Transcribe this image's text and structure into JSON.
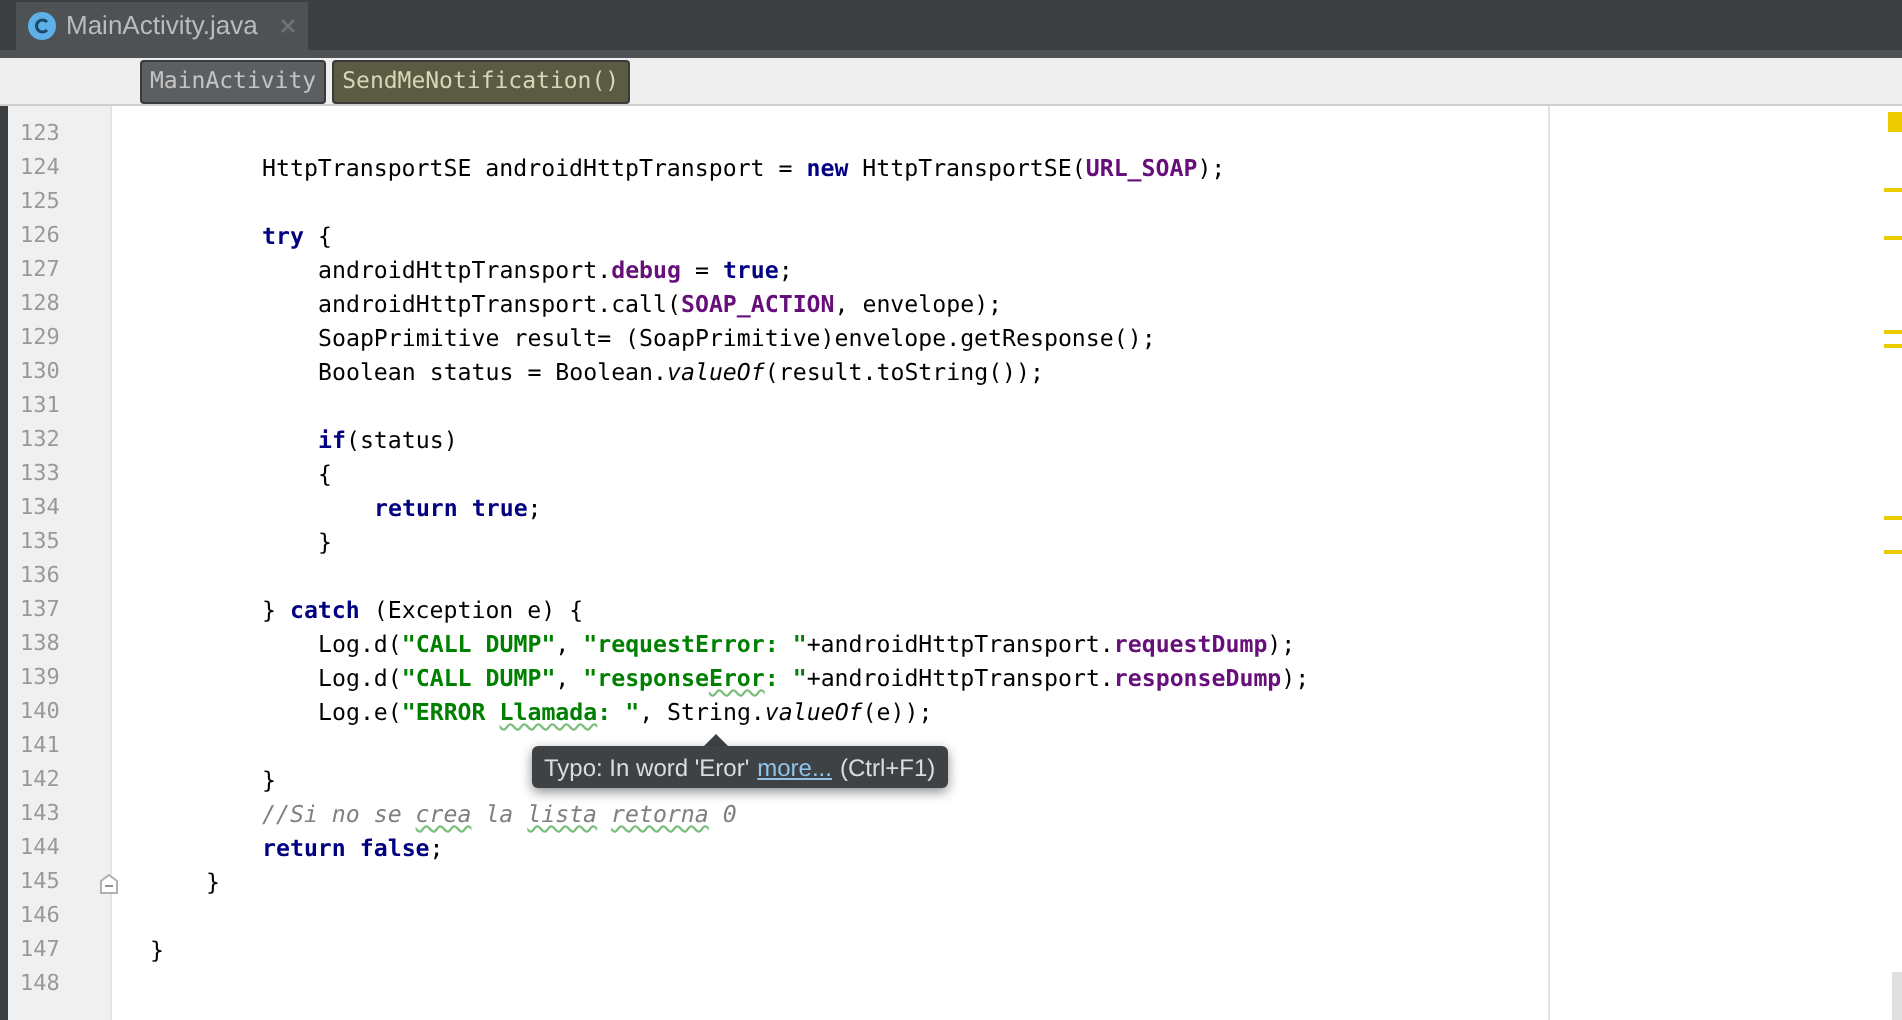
{
  "tabs": [
    {
      "label": "MainActivity.java",
      "selected": true
    }
  ],
  "breadcrumbs": [
    {
      "label": "MainActivity",
      "selected": false
    },
    {
      "label": "SendMeNotification()",
      "selected": true
    }
  ],
  "editor": {
    "lines": [
      {
        "number": "123",
        "fold": false
      },
      {
        "number": "124",
        "fold": false,
        "tokens": [
          {
            "text": "        HttpTransportSE androidHttpTransport = ",
            "kind": "plain"
          },
          {
            "text": "new",
            "kind": "keyword"
          },
          {
            "text": " HttpTransportSE(",
            "kind": "plain"
          },
          {
            "text": "URL_SOAP",
            "kind": "field"
          },
          {
            "text": ");",
            "kind": "plain"
          }
        ]
      },
      {
        "number": "125",
        "fold": false
      },
      {
        "number": "126",
        "fold": false,
        "tokens": [
          {
            "text": "        try",
            "kind": "keyword"
          },
          {
            "text": " {",
            "kind": "plain"
          }
        ]
      },
      {
        "number": "127",
        "fold": false,
        "tokens": [
          {
            "text": "            androidHttpTransport.",
            "kind": "plain"
          },
          {
            "text": "debug",
            "kind": "field"
          },
          {
            "text": " = ",
            "kind": "plain"
          },
          {
            "text": "true",
            "kind": "keyword"
          },
          {
            "text": ";",
            "kind": "plain"
          }
        ]
      },
      {
        "number": "128",
        "fold": false,
        "tokens": [
          {
            "text": "            androidHttpTransport.call(",
            "kind": "plain"
          },
          {
            "text": "SOAP_ACTION",
            "kind": "field"
          },
          {
            "text": ", envelope);",
            "kind": "plain"
          }
        ]
      },
      {
        "number": "129",
        "fold": false,
        "tokens": [
          {
            "text": "            SoapPrimitive result= (SoapPrimitive)envelope.getResponse();",
            "kind": "plain"
          }
        ]
      },
      {
        "number": "130",
        "fold": false,
        "tokens": [
          {
            "text": "            Boolean status = Boolean.",
            "kind": "plain"
          },
          {
            "text": "valueOf",
            "kind": "static"
          },
          {
            "text": "(result.toString());",
            "kind": "plain"
          }
        ]
      },
      {
        "number": "131",
        "fold": false
      },
      {
        "number": "132",
        "fold": false,
        "tokens": [
          {
            "text": "            if",
            "kind": "keyword"
          },
          {
            "text": "(status)",
            "kind": "plain"
          }
        ]
      },
      {
        "number": "133",
        "fold": false,
        "tokens": [
          {
            "text": "            {",
            "kind": "plain"
          }
        ]
      },
      {
        "number": "134",
        "fold": false,
        "tokens": [
          {
            "text": "                return",
            "kind": "keyword"
          },
          {
            "text": " true",
            "kind": "keyword"
          },
          {
            "text": ";",
            "kind": "plain"
          }
        ]
      },
      {
        "number": "135",
        "fold": false,
        "tokens": [
          {
            "text": "            }",
            "kind": "plain"
          }
        ]
      },
      {
        "number": "136",
        "fold": false
      },
      {
        "number": "137",
        "fold": false,
        "tokens": [
          {
            "text": "        } ",
            "kind": "plain"
          },
          {
            "text": "catch",
            "kind": "keyword"
          },
          {
            "text": " (Exception e) {",
            "kind": "plain"
          }
        ]
      },
      {
        "number": "138",
        "fold": false,
        "tokens": [
          {
            "text": "            Log.d(",
            "kind": "plain"
          },
          {
            "text": "\"CALL DUMP\"",
            "kind": "string"
          },
          {
            "text": ", ",
            "kind": "plain"
          },
          {
            "text": "\"requestError: \"",
            "kind": "string"
          },
          {
            "text": "+androidHttpTransport.",
            "kind": "plain"
          },
          {
            "text": "requestDump",
            "kind": "field"
          },
          {
            "text": ");",
            "kind": "plain"
          }
        ]
      },
      {
        "number": "139",
        "fold": false,
        "tokens": [
          {
            "text": "            Log.d(",
            "kind": "plain"
          },
          {
            "text": "\"CALL DUMP\"",
            "kind": "string"
          },
          {
            "text": ", ",
            "kind": "plain"
          },
          {
            "text": "\"response",
            "kind": "string"
          },
          {
            "text": "Eror",
            "kind": "string_typo"
          },
          {
            "text": ": \"",
            "kind": "string"
          },
          {
            "text": "+androidHttpTransport.",
            "kind": "plain"
          },
          {
            "text": "responseDump",
            "kind": "field"
          },
          {
            "text": ");",
            "kind": "plain"
          }
        ]
      },
      {
        "number": "140",
        "fold": false,
        "tokens": [
          {
            "text": "            Log.e(",
            "kind": "plain"
          },
          {
            "text": "\"ERROR ",
            "kind": "string"
          },
          {
            "text": "Llamada",
            "kind": "string_typo"
          },
          {
            "text": ": \"",
            "kind": "string"
          },
          {
            "text": ", String.",
            "kind": "plain"
          },
          {
            "text": "valueOf",
            "kind": "static"
          },
          {
            "text": "(e));",
            "kind": "plain"
          }
        ]
      },
      {
        "number": "141",
        "fold": false
      },
      {
        "number": "142",
        "fold": false,
        "tokens": [
          {
            "text": "        }",
            "kind": "plain"
          }
        ]
      },
      {
        "number": "143",
        "fold": false,
        "tokens": [
          {
            "text": "        //Si no se ",
            "kind": "comment"
          },
          {
            "text": "crea",
            "kind": "comment_typo"
          },
          {
            "text": " la ",
            "kind": "comment"
          },
          {
            "text": "lista",
            "kind": "comment_typo"
          },
          {
            "text": " retorna",
            "kind": "comment_typo"
          },
          {
            "text": " 0",
            "kind": "comment"
          }
        ]
      },
      {
        "number": "144",
        "fold": false,
        "tokens": [
          {
            "text": "        return",
            "kind": "keyword"
          },
          {
            "text": " false",
            "kind": "keyword"
          },
          {
            "text": ";",
            "kind": "plain"
          }
        ]
      },
      {
        "number": "145",
        "fold": true,
        "tokens": [
          {
            "text": "    }",
            "kind": "plain"
          }
        ]
      },
      {
        "number": "146",
        "fold": false
      },
      {
        "number": "147",
        "fold": false,
        "tokens": [
          {
            "text": "}",
            "kind": "plain"
          }
        ]
      },
      {
        "number": "148",
        "fold": false
      }
    ]
  },
  "tooltip": {
    "message": "Typo: In word 'Eror'",
    "link": "more...",
    "shortcut": "(Ctrl+F1)"
  }
}
